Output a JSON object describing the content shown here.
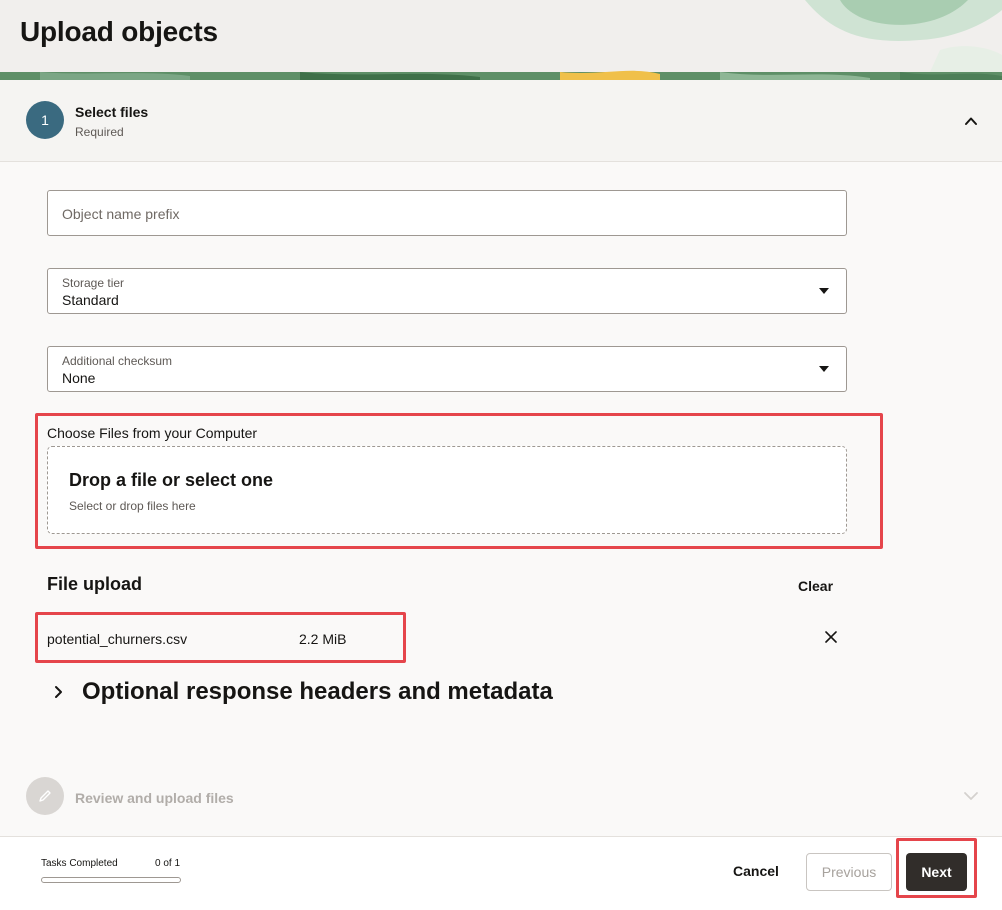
{
  "header": {
    "title": "Upload objects"
  },
  "steps": {
    "step1": {
      "number": "1",
      "title": "Select files",
      "subtitle": "Required"
    },
    "step2": {
      "title": "Review and upload files"
    }
  },
  "form": {
    "prefix_placeholder": "Object name prefix",
    "storage_tier": {
      "label": "Storage tier",
      "value": "Standard"
    },
    "checksum": {
      "label": "Additional checksum",
      "value": "None"
    },
    "choose_files_label": "Choose Files from your Computer",
    "dropzone": {
      "title": "Drop a file or select one",
      "subtitle": "Select or drop files here"
    }
  },
  "file_upload": {
    "title": "File upload",
    "clear_label": "Clear",
    "files": [
      {
        "name": "potential_churners.csv",
        "size": "2.2 MiB"
      }
    ]
  },
  "optional_section": {
    "title": "Optional response headers and metadata"
  },
  "footer": {
    "tasks_label": "Tasks Completed",
    "tasks_count": "0 of 1",
    "progress": 0,
    "cancel_label": "Cancel",
    "previous_label": "Previous",
    "next_label": "Next"
  },
  "colors": {
    "highlight": "#e5454b",
    "step_badge": "#3a6a80",
    "primary_button": "#312d2a"
  },
  "icons": [
    "chevron-up-icon",
    "close-icon",
    "chevron-right-icon",
    "pencil-icon",
    "chevron-down-icon",
    "caret-down-icon"
  ]
}
